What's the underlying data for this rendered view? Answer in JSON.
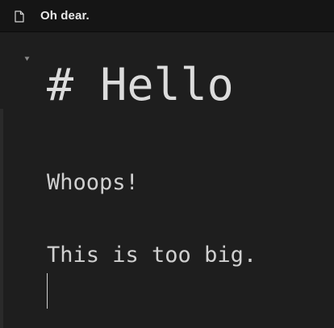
{
  "window": {
    "title": "Oh dear.",
    "file_icon": "document-icon"
  },
  "editor": {
    "fold_icon": "fold-triangle-icon",
    "heading": "# Hello",
    "lines": [
      "Whoops!",
      "This is too big."
    ],
    "cursor_line": 3
  }
}
